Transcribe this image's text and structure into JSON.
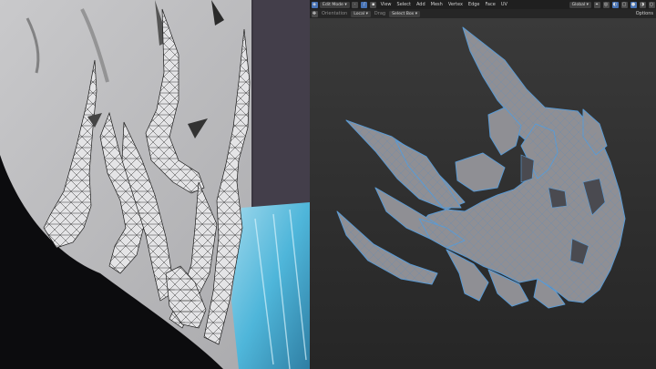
{
  "header": {
    "mode_label": "Edit Mode",
    "menu": [
      "View",
      "Select",
      "Add",
      "Mesh",
      "Vertex",
      "Edge",
      "Face",
      "UV"
    ],
    "shading_label": "Global",
    "overlay_label": "Options"
  },
  "toolbar": {
    "orientation_label": "Orientation",
    "orientation_value": "Local",
    "drag_label": "Drag",
    "drag_value": "Select Box"
  },
  "icons": {
    "uv_panel": "uv-editor",
    "viewport": "3d-viewport"
  },
  "colors": {
    "mesh_fill": "#8f8f94",
    "mesh_edge": "#5a9bd5",
    "selection": "#4772b3",
    "mode_accent": "#c7792a"
  }
}
